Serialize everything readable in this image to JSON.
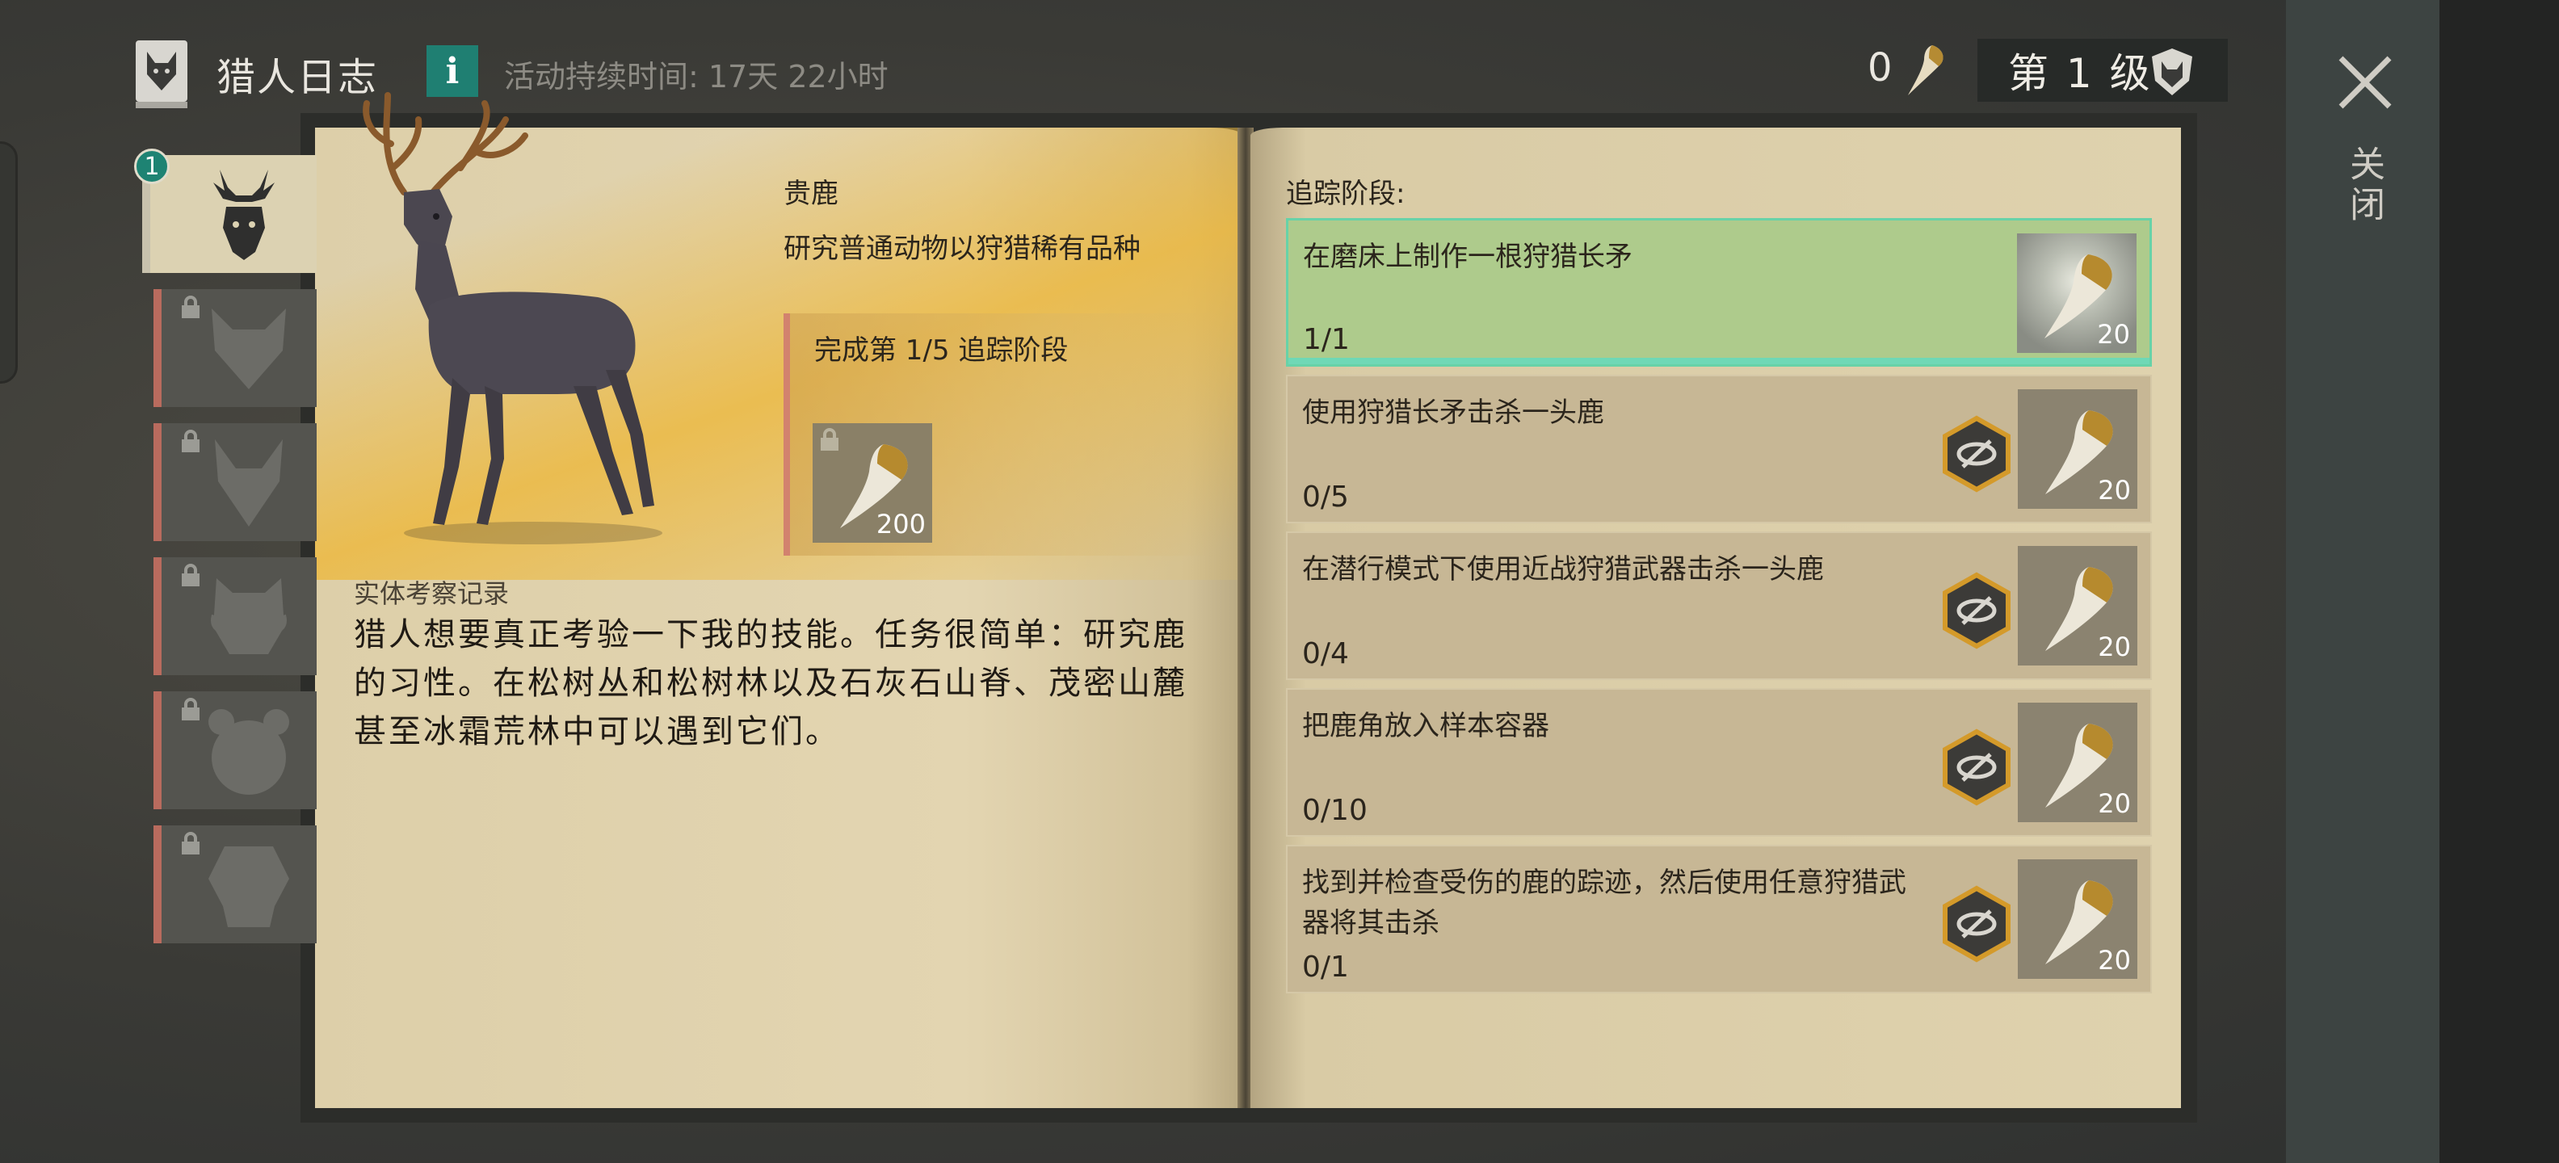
{
  "header": {
    "title": "猎人日志",
    "info_label": "i",
    "duration": "活动持续时间:  17天 22小时",
    "currency_count": "0",
    "level": "第 1 级"
  },
  "close": {
    "label": "关闭"
  },
  "sidebar": {
    "badge": "1",
    "tabs": [
      {
        "animal": "deer-icon",
        "locked": false,
        "active": true
      },
      {
        "animal": "wolf-icon",
        "locked": true
      },
      {
        "animal": "fox-icon",
        "locked": true
      },
      {
        "animal": "boar-icon",
        "locked": true
      },
      {
        "animal": "bear-icon",
        "locked": true
      },
      {
        "animal": "monkey-icon",
        "locked": true
      }
    ]
  },
  "left_page": {
    "animal_name": "贵鹿",
    "animal_desc": "研究普通动物以狩猎稀有品种",
    "stage_text": "完成第 1/5 追踪阶段",
    "stage_reward": "200",
    "field_title": "实体考察记录",
    "field_text": "猎人想要真正考验一下我的技能。任务很简单：研究鹿的习性。在松树丛和松树林以及石灰石山脊、茂密山麓甚至冰霜荒林中可以遇到它们。"
  },
  "right_page": {
    "tracking_label": "追踪阶段:",
    "tasks": [
      {
        "text": "在磨床上制作一根狩猎长矛",
        "progress": "1/1",
        "reward": "20",
        "done": true
      },
      {
        "text": "使用狩猎长矛击杀一头鹿",
        "progress": "0/5",
        "reward": "20",
        "done": false
      },
      {
        "text": "在潜行模式下使用近战狩猎武器击杀一头鹿",
        "progress": "0/4",
        "reward": "20",
        "done": false
      },
      {
        "text": "把鹿角放入样本容器",
        "progress": "0/10",
        "reward": "20",
        "done": false
      },
      {
        "text": "找到并检查受伤的鹿的踪迹，然后使用任意狩猎武器将其击杀",
        "progress": "0/1",
        "reward": "20",
        "done": false
      }
    ]
  },
  "colors": {
    "accent_teal": "#1f7f72",
    "done_green": "#aecb8c",
    "highlight_cyan": "#67d2a8",
    "page_gold": "#ecb941"
  }
}
